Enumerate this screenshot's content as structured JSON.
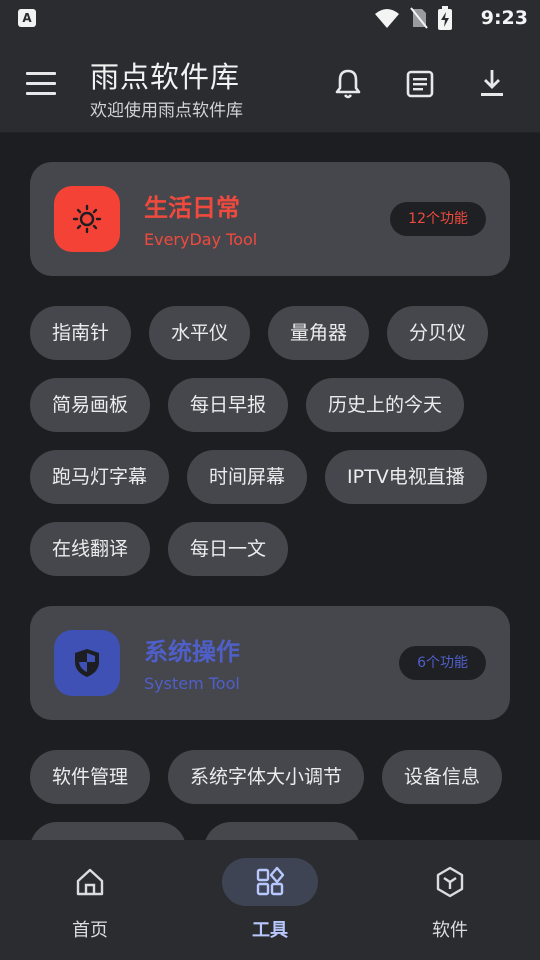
{
  "status": {
    "indicator": "A",
    "time": "9:23"
  },
  "header": {
    "title": "雨点软件库",
    "subtitle": "欢迎使用雨点软件库"
  },
  "sections": [
    {
      "title": "生活日常",
      "subtitle": "EveryDay Tool",
      "badge": "12个功能",
      "accent": "#f04a3e",
      "icon_color": "#f44336",
      "icon": "sun-icon",
      "tools": [
        "指南针",
        "水平仪",
        "量角器",
        "分贝仪",
        "简易画板",
        "每日早报",
        "历史上的今天",
        "跑马灯字幕",
        "时间屏幕",
        "IPTV电视直播",
        "在线翻译",
        "每日一文"
      ]
    },
    {
      "title": "系统操作",
      "subtitle": "System Tool",
      "badge": "6个功能",
      "accent": "#4f5fc9",
      "icon_color": "#3f51b5",
      "icon": "shield-icon",
      "tools": [
        "软件管理",
        "系统字体大小调节",
        "设备信息"
      ]
    }
  ],
  "bottom_nav": [
    {
      "label": "首页",
      "icon": "home-icon"
    },
    {
      "label": "工具",
      "icon": "grid-icon",
      "active": true
    },
    {
      "label": "软件",
      "icon": "cube-icon"
    }
  ]
}
